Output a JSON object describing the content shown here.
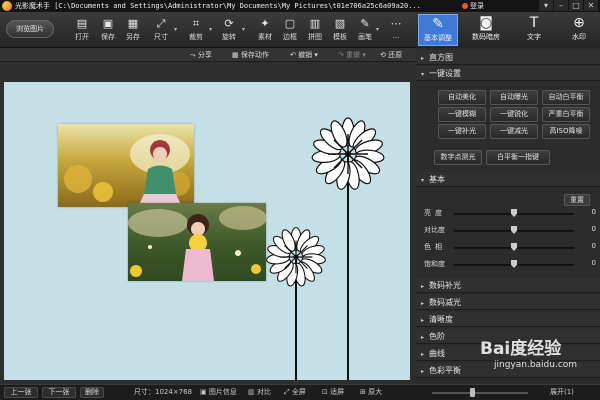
{
  "titlebar": {
    "title": "光影魔术手 [C:\\Documents and Settings\\Administrator\\My Documents\\My Pictures\\t01e706a25c6a09a20...",
    "login": "登录",
    "win_buttons": [
      "▾",
      "–",
      "□",
      "✕"
    ]
  },
  "toolbar": {
    "browse": "浏览图片",
    "tools": [
      {
        "label": "打开",
        "icon": "open-icon",
        "glyph": "▤"
      },
      {
        "label": "保存",
        "icon": "save-icon",
        "glyph": "▣"
      },
      {
        "label": "另存",
        "icon": "save-as-icon",
        "glyph": "▦"
      },
      {
        "label": "尺寸",
        "icon": "resize-icon",
        "glyph": "⤢"
      },
      {
        "label": "裁剪",
        "icon": "crop-icon",
        "glyph": "⌗"
      },
      {
        "label": "旋转",
        "icon": "rotate-icon",
        "glyph": "⟳"
      },
      {
        "label": "素材",
        "icon": "material-icon",
        "glyph": "✦"
      },
      {
        "label": "边框",
        "icon": "border-icon",
        "glyph": "▢"
      },
      {
        "label": "拼图",
        "icon": "collage-icon",
        "glyph": "▥"
      },
      {
        "label": "模板",
        "icon": "template-icon",
        "glyph": "▧"
      },
      {
        "label": "画笔",
        "icon": "brush-icon",
        "glyph": "✎"
      },
      {
        "label": "...",
        "icon": "more-icon",
        "glyph": "⋯"
      }
    ]
  },
  "right_tabs": [
    {
      "label": "基本调整",
      "icon": "adjust-icon",
      "glyph": "✎"
    },
    {
      "label": "数码暗房",
      "icon": "darkroom-icon",
      "glyph": "◙"
    },
    {
      "label": "文字",
      "icon": "text-icon",
      "glyph": "T"
    },
    {
      "label": "水印",
      "icon": "watermark-icon",
      "glyph": "⊕"
    }
  ],
  "actions": {
    "share": "分享",
    "save_action": "保存动作",
    "undo": "撤销",
    "redo": "重做",
    "restore": "还原"
  },
  "panel": {
    "histogram": "直方图",
    "one_click": "一键设置",
    "buttons_row1": [
      "自动美化",
      "自动曝光",
      "自动白平衡"
    ],
    "buttons_row2": [
      "一键模糊",
      "一键锐化",
      "严重白平衡"
    ],
    "buttons_row3": [
      "一键补光",
      "一键减光",
      "高ISO降噪"
    ],
    "buttons_row4": [
      "数字点测光",
      "白平衡一指键"
    ],
    "basic": "基本",
    "reset": "重置",
    "sliders": [
      {
        "label": "亮度",
        "value": "0",
        "level": 0.5
      },
      {
        "label": "对比度",
        "value": "0",
        "level": 0.5
      },
      {
        "label": "色相",
        "value": "0",
        "level": 0.5
      },
      {
        "label": "饱和度",
        "value": "0",
        "level": 0.5
      }
    ],
    "sections": [
      "数码补光",
      "数码减光",
      "清晰度",
      "色阶",
      "曲线",
      "色彩平衡"
    ]
  },
  "statusbar": {
    "prev": "上一张",
    "next": "下一张",
    "delete": "删除",
    "size": "尺寸：1024×768",
    "info": "图片信息",
    "compare": "对比",
    "fullscreen": "全屏",
    "fit": "适屏",
    "original": "原大",
    "expand": "展开(1)"
  },
  "watermark": {
    "brand": "Bai度经验",
    "url": "jingyan.baidu.com"
  },
  "colors": {
    "canvas_bg": "#c4e0e6",
    "active_tab": "#3e7ad6"
  }
}
